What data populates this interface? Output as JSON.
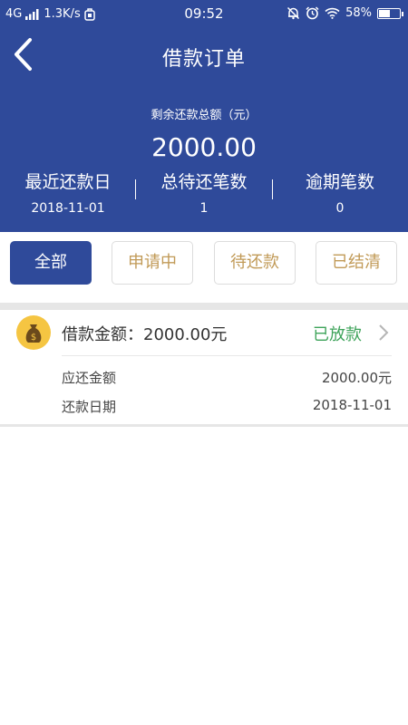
{
  "status_bar": {
    "network": "4G",
    "speed": "1.3K/s",
    "time": "09:52",
    "battery": "58%",
    "battery_level": 0.58
  },
  "nav": {
    "title": "借款订单"
  },
  "summary": {
    "remaining_label": "剩余还款总额（元）",
    "remaining_amount": "2000.00",
    "stats": [
      {
        "label": "最近还款日",
        "value": "2018-11-01"
      },
      {
        "label": "总待还笔数",
        "value": "1"
      },
      {
        "label": "逾期笔数",
        "value": "0"
      }
    ]
  },
  "tabs": [
    {
      "label": "全部",
      "active": true
    },
    {
      "label": "申请中",
      "active": false
    },
    {
      "label": "待还款",
      "active": false
    },
    {
      "label": "已结清",
      "active": false
    }
  ],
  "orders": [
    {
      "title": "借款金额：2000.00元",
      "status": "已放款",
      "details": [
        {
          "label": "应还金额",
          "value": "2000.00元"
        },
        {
          "label": "还款日期",
          "value": "2018-11-01"
        }
      ]
    }
  ],
  "colors": {
    "primary": "#2f4a9a",
    "tab_text": "#c19a57",
    "status_green": "#3ea35a"
  }
}
